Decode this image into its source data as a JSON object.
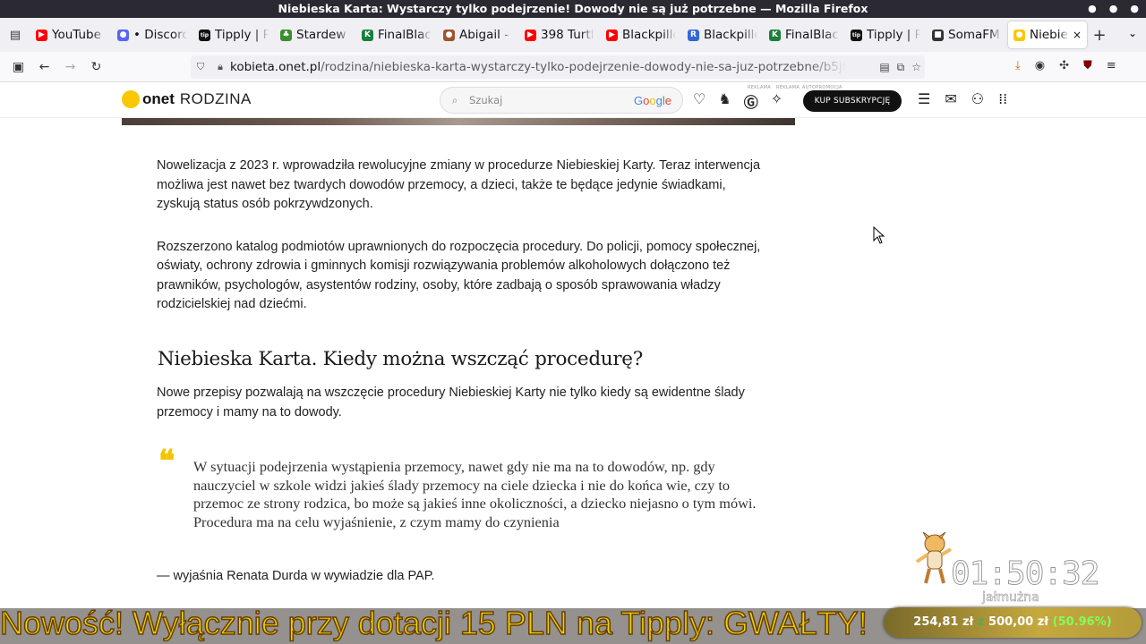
{
  "window": {
    "title": "Niebieska Karta: Wystarczy tylko podejrzenie! Dowody nie są już potrzebne — Mozilla Firefox",
    "controls": [
      "●",
      "●",
      "●"
    ]
  },
  "tabs": [
    {
      "label": "YouTube",
      "icon": "youtube-icon",
      "color": "#ff0000",
      "glyph": "▶"
    },
    {
      "label": "• Discord",
      "icon": "discord-icon",
      "color": "#5865f2",
      "glyph": "●"
    },
    {
      "label": "Tipply | Re",
      "icon": "tipply-icon",
      "color": "#111111",
      "glyph": "tip"
    },
    {
      "label": "Stardew V",
      "icon": "stardew-icon",
      "color": "#3c8d2f",
      "glyph": "♣"
    },
    {
      "label": "FinalBlack",
      "icon": "finalblack-icon",
      "color": "#1a7f3a",
      "glyph": "K"
    },
    {
      "label": "Abigail - S",
      "icon": "abigail-icon",
      "color": "#a0522d",
      "glyph": "●"
    },
    {
      "label": "398 Turtle",
      "icon": "youtube-icon",
      "color": "#ff0000",
      "glyph": "▶"
    },
    {
      "label": "Blackpilled",
      "icon": "youtube-icon",
      "color": "#ff0000",
      "glyph": "▶"
    },
    {
      "label": "Blackpilled",
      "icon": "blackpilled-icon",
      "color": "#3367d6",
      "glyph": "R"
    },
    {
      "label": "FinalBlack",
      "icon": "finalblack-icon",
      "color": "#1a7f3a",
      "glyph": "K"
    },
    {
      "label": "Tipply | Re",
      "icon": "tipply-icon",
      "color": "#111111",
      "glyph": "tip"
    },
    {
      "label": "SomaFM",
      "icon": "somafm-icon",
      "color": "#333333",
      "glyph": "■"
    },
    {
      "label": "Niebieska",
      "icon": "onet-icon",
      "color": "#f9c800",
      "glyph": "●",
      "active": true
    }
  ],
  "urlbar": {
    "host": "kobieta.onet.pl",
    "path": "/rodzina/niebieska-karta-wystarczy-tylko-podejrzenie-dowody-nie-sa-juz-potrzebne/b5jf"
  },
  "site": {
    "brand": "onet",
    "section": "RODZINA",
    "search_placeholder": "Szukaj",
    "search_provider": "Google",
    "ad_label_1": "REKLAMA",
    "ad_label_2": "REKLAMA",
    "ad_label_3": "AUTOPROMOCJA",
    "subscribe_label": "KUP SUBSKRYPCJĘ"
  },
  "article": {
    "p1": "Nowelizacja z 2023 r. wprowadziła rewolucyjne zmiany w procedurze Niebieskiej Karty. Teraz interwencja możliwa jest nawet bez twardych dowodów przemocy, a dzieci, także te będące jedynie świadkami, zyskują status osób pokrzywdzonych.",
    "p2": "Rozszerzono katalog podmiotów uprawnionych do rozpoczęcia procedury. Do policji, pomocy społecznej, oświaty, ochrony zdrowia i gminnych komisji rozwiązywania problemów alkoholowych dołączono też prawników, psychologów, asystentów rodziny, osoby, które zadbają o sposób sprawowania władzy rodzicielskiej nad dziećmi.",
    "heading": "Niebieska Karta. Kiedy można wszcząć procedurę?",
    "p3": "Nowe przepisy pozwalają na wszczęcie procedury Niebieskiej Karty nie tylko kiedy są ewidentne ślady przemocy i mamy na to dowody.",
    "quote": "W sytuacji podejrzenia wystąpienia przemocy, nawet gdy nie ma na to dowodów, np. gdy nauczyciel w szkole widzi jakieś ślady przemocy na ciele dziecka i nie do końca wie, czy to przemoc ze strony rodzica, bo może są jakieś inne okoliczności, a dziecko niejasno o tym mówi. Procedura ma na celu wyjaśnienie, z czym mamy do czynienia",
    "quote_mark": "❝",
    "attribution": "— wyjaśnia Renata Durda w wywiadzie dla PAP."
  },
  "stream_overlay": {
    "ticker": "Nowość! Wyłącznie przy dotacji 15 PLN na Tipply: GWAŁTY!",
    "goal_current": "254,81 zł",
    "goal_sep": "z",
    "goal_target": "500,00 zł",
    "goal_percent": "(50.96%)",
    "goal_fraction": 0.5096,
    "timer": "01:50:32",
    "timer_label": "jałmużna",
    "accent": "#e8d400"
  }
}
